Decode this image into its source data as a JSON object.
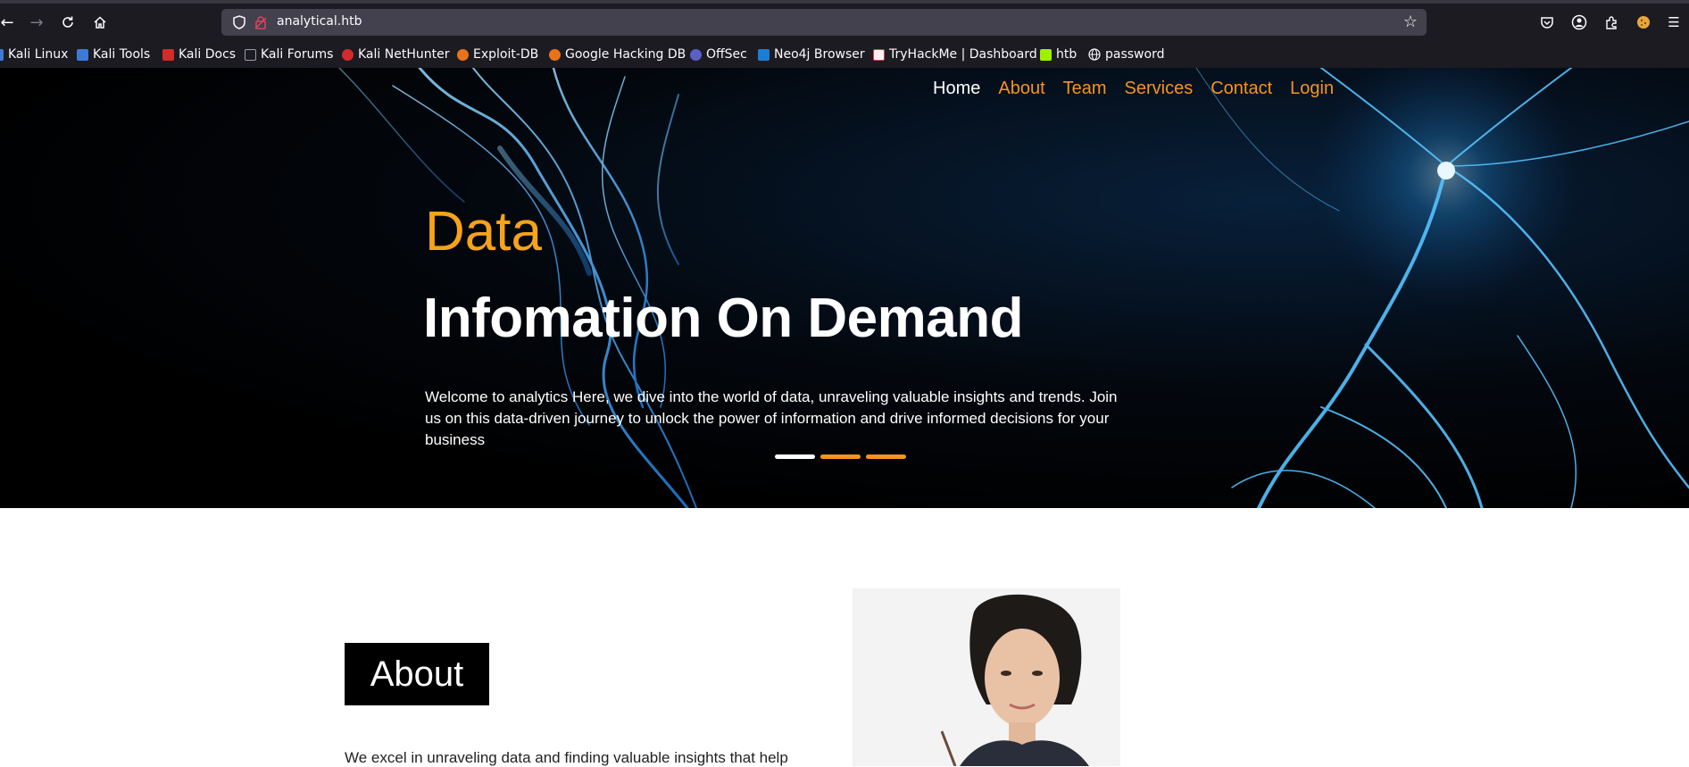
{
  "browser": {
    "url": "analytical.htb",
    "bookmarks": [
      {
        "label": "Kali Linux",
        "color": "#3d7ad6"
      },
      {
        "label": "Kali Tools",
        "color": "#3d7ad6"
      },
      {
        "label": "Kali Docs",
        "color": "#d42a2a"
      },
      {
        "label": "Kali Forums",
        "color": "#9aa0a6"
      },
      {
        "label": "Kali NetHunter",
        "color": "#d42a2a"
      },
      {
        "label": "Exploit-DB",
        "color": "#e8731a"
      },
      {
        "label": "Google Hacking DB",
        "color": "#e8731a"
      },
      {
        "label": "OffSec",
        "color": "#5b5fc7"
      },
      {
        "label": "Neo4j Browser",
        "color": "#1a7fd4"
      },
      {
        "label": "TryHackMe | Dashboard",
        "color": "#c4c4c4"
      },
      {
        "label": "htb",
        "color": "#9fef00"
      },
      {
        "label": "password",
        "color": "#fbfbfe"
      }
    ]
  },
  "site": {
    "nav": [
      "Home",
      "About",
      "Team",
      "Services",
      "Contact",
      "Login"
    ],
    "hero": {
      "kicker": "Data",
      "title": "Infomation On Demand",
      "text": "Welcome to analytics Here, we dive into the world of data, unraveling valuable insights and trends. Join us on this data-driven journey to unlock the power of information and drive informed decisions for your business"
    },
    "about": {
      "heading": "About",
      "text": "We excel in unraveling data and finding valuable insights that help"
    }
  },
  "colors": {
    "accent": "#f7931e",
    "hero_kicker": "#f7a21b",
    "chrome_bg": "#1c1b22",
    "urlbar_bg": "#42414d"
  }
}
